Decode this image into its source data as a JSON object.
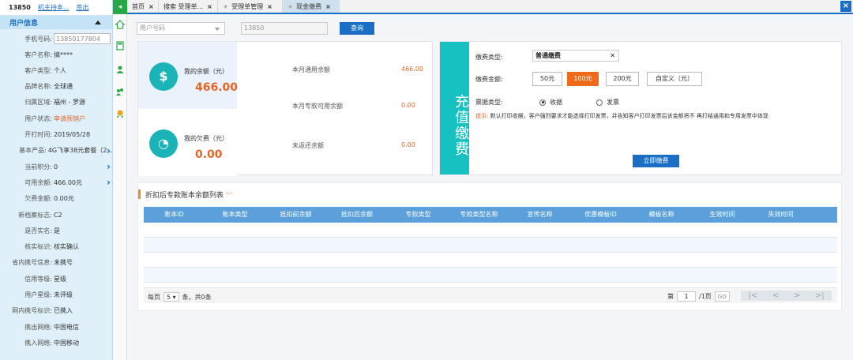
{
  "user_top": {
    "phone": "13850",
    "role": "机主持本...",
    "logout": "签出"
  },
  "panel": {
    "title": "用户信息",
    "phone_label": "手机号码:",
    "phone_value": "13850177804",
    "rows": [
      {
        "label": "客户名称:",
        "value": "搞****"
      },
      {
        "label": "客户类型:",
        "value": "个人"
      },
      {
        "label": "品牌名称:",
        "value": "全球通"
      },
      {
        "label": "归属区域:",
        "value": "福州 - 罗源"
      },
      {
        "label": "用户状态:",
        "value": "申请预销户"
      },
      {
        "label": "开打时间:",
        "value": "2019/05/28"
      },
      {
        "label": "基本产品:",
        "value": "4G飞享38元套餐（2..."
      },
      {
        "label": "当前积分:",
        "value": "0"
      },
      {
        "label": "可用余额:",
        "value": "466.00元"
      },
      {
        "label": "欠费金额:",
        "value": "0.00元"
      },
      {
        "label": "新档案标志:",
        "value": "C2"
      },
      {
        "label": "是否实名:",
        "value": "是"
      },
      {
        "label": "核实标识:",
        "value": "核实确认"
      },
      {
        "label": "省内携号信息:",
        "value": "未携号"
      },
      {
        "label": "信用等级:",
        "value": "星级"
      },
      {
        "label": "用户星级:",
        "value": "未评级"
      },
      {
        "label": "网内携号标识:",
        "value": "已携入"
      },
      {
        "label": "携出网络:",
        "value": "中国电信"
      },
      {
        "label": "携入网络:",
        "value": "中国移动"
      }
    ]
  },
  "tabs": [
    {
      "label": "首页"
    },
    {
      "label": "搜索 受理单..."
    },
    {
      "label": "受理单管理"
    },
    {
      "label": "现金缴费"
    }
  ],
  "search": {
    "select_placeholder": "用户号码",
    "number_value": "13850",
    "query_label": "查询"
  },
  "balance": {
    "my_balance_label": "我的余额（元）",
    "my_balance_value": "466.00",
    "my_arrears_label": "我的欠费（元）",
    "my_arrears_value": "0.00",
    "items": [
      {
        "label": "本月通用余额",
        "value": "466.00"
      },
      {
        "label": "本月专款可用余额",
        "value": "0.00"
      },
      {
        "label": "未返还余额",
        "value": "0.00"
      }
    ]
  },
  "pay": {
    "side_title": "充值缴费",
    "type_label": "缴费类型:",
    "type_value": "普通缴费",
    "amount_label": "缴费金额:",
    "amounts": [
      "50元",
      "100元",
      "200元",
      "自定义（元）"
    ],
    "selected_amount": "100元",
    "invoice_label": "票据类型:",
    "invoice_options": [
      "收据",
      "发票"
    ],
    "invoice_selected": "收据",
    "tip_label": "提示:",
    "tip_text": "默认打印收据，客户强烈要求才能选择打印发票，并告知客户打印发票后该金额将不 再打结通用和专用发票中体现",
    "pay_now": "立即缴费"
  },
  "list": {
    "title": "折扣后专款账本余额列表",
    "columns": [
      "账本ID",
      "账本类型",
      "抵扣前余额",
      "抵扣后余额",
      "专款类型",
      "专款类型名称",
      "宣传名称",
      "优惠模板ID",
      "模板名称",
      "生效时间",
      "失效时间"
    ],
    "rows": []
  },
  "pager": {
    "per_page_label": "每页",
    "per_page_value": "5",
    "summary": "条，共0条",
    "page_prefix": "第",
    "page_value": "1",
    "page_suffix": "/1页",
    "go": "GO"
  }
}
